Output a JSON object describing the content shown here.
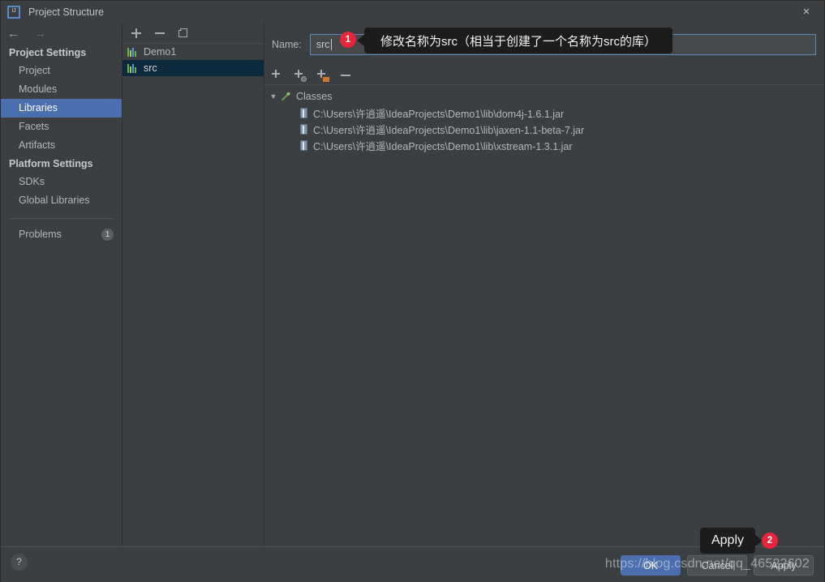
{
  "window": {
    "title": "Project Structure",
    "logo_text": "IJ",
    "close_label": "×"
  },
  "nav": {
    "back_arrow": "←",
    "forward_arrow": "→",
    "groups": [
      {
        "title": "Project Settings",
        "items": [
          {
            "label": "Project",
            "selected": false
          },
          {
            "label": "Modules",
            "selected": false
          },
          {
            "label": "Libraries",
            "selected": true
          },
          {
            "label": "Facets",
            "selected": false
          },
          {
            "label": "Artifacts",
            "selected": false
          }
        ]
      },
      {
        "title": "Platform Settings",
        "items": [
          {
            "label": "SDKs",
            "selected": false
          },
          {
            "label": "Global Libraries",
            "selected": false
          }
        ]
      }
    ],
    "problems": {
      "label": "Problems",
      "count": "1"
    }
  },
  "library_list": {
    "toolbar": [
      {
        "name": "add-library-button",
        "icon": "plus-icon"
      },
      {
        "name": "remove-library-button",
        "icon": "minus-icon"
      },
      {
        "name": "copy-library-button",
        "icon": "copy-icon"
      }
    ],
    "items": [
      {
        "label": "Demo1",
        "selected": false
      },
      {
        "label": "src",
        "selected": true
      }
    ]
  },
  "detail": {
    "name_label_pre": "N",
    "name_label_mid": "a",
    "name_label_post": "me:",
    "name_label_full": "Name:",
    "name_value": "src",
    "toolbar": [
      {
        "name": "add-item-button",
        "icon": "plus-icon"
      },
      {
        "name": "add-from-maven-button",
        "icon": "plus-globe-icon"
      },
      {
        "name": "add-from-directory-button",
        "icon": "plus-folder-icon"
      },
      {
        "name": "remove-item-button",
        "icon": "minus-icon"
      }
    ],
    "tree": {
      "root_label": "Classes",
      "root_icon": "hammer-icon",
      "expanded_glyph": "▼",
      "children": [
        "C:\\Users\\许逍遥\\IdeaProjects\\Demo1\\lib\\dom4j-1.6.1.jar",
        "C:\\Users\\许逍遥\\IdeaProjects\\Demo1\\lib\\jaxen-1.1-beta-7.jar",
        "C:\\Users\\许逍遥\\IdeaProjects\\Demo1\\lib\\xstream-1.3.1.jar"
      ]
    }
  },
  "callouts": {
    "name_tooltip": "修改名称为src（相当于创建了一个名称为src的库）",
    "name_badge": "1",
    "apply_tooltip": "Apply",
    "apply_badge": "2"
  },
  "footer": {
    "help_label": "?",
    "buttons": [
      {
        "label": "OK",
        "primary": true
      },
      {
        "label": "Cancel",
        "primary": false
      },
      {
        "label": "Apply",
        "primary": false
      }
    ],
    "watermark": "https://blog.csdn.net/qq_46522602"
  },
  "colors": {
    "accent_selection": "#4b6eaf",
    "list_selection": "#0d293e",
    "badge_red": "#e8253a",
    "window_bg": "#3c3f41",
    "folder_orange": "#cc7832",
    "jar_blue": "#7f94a8"
  }
}
